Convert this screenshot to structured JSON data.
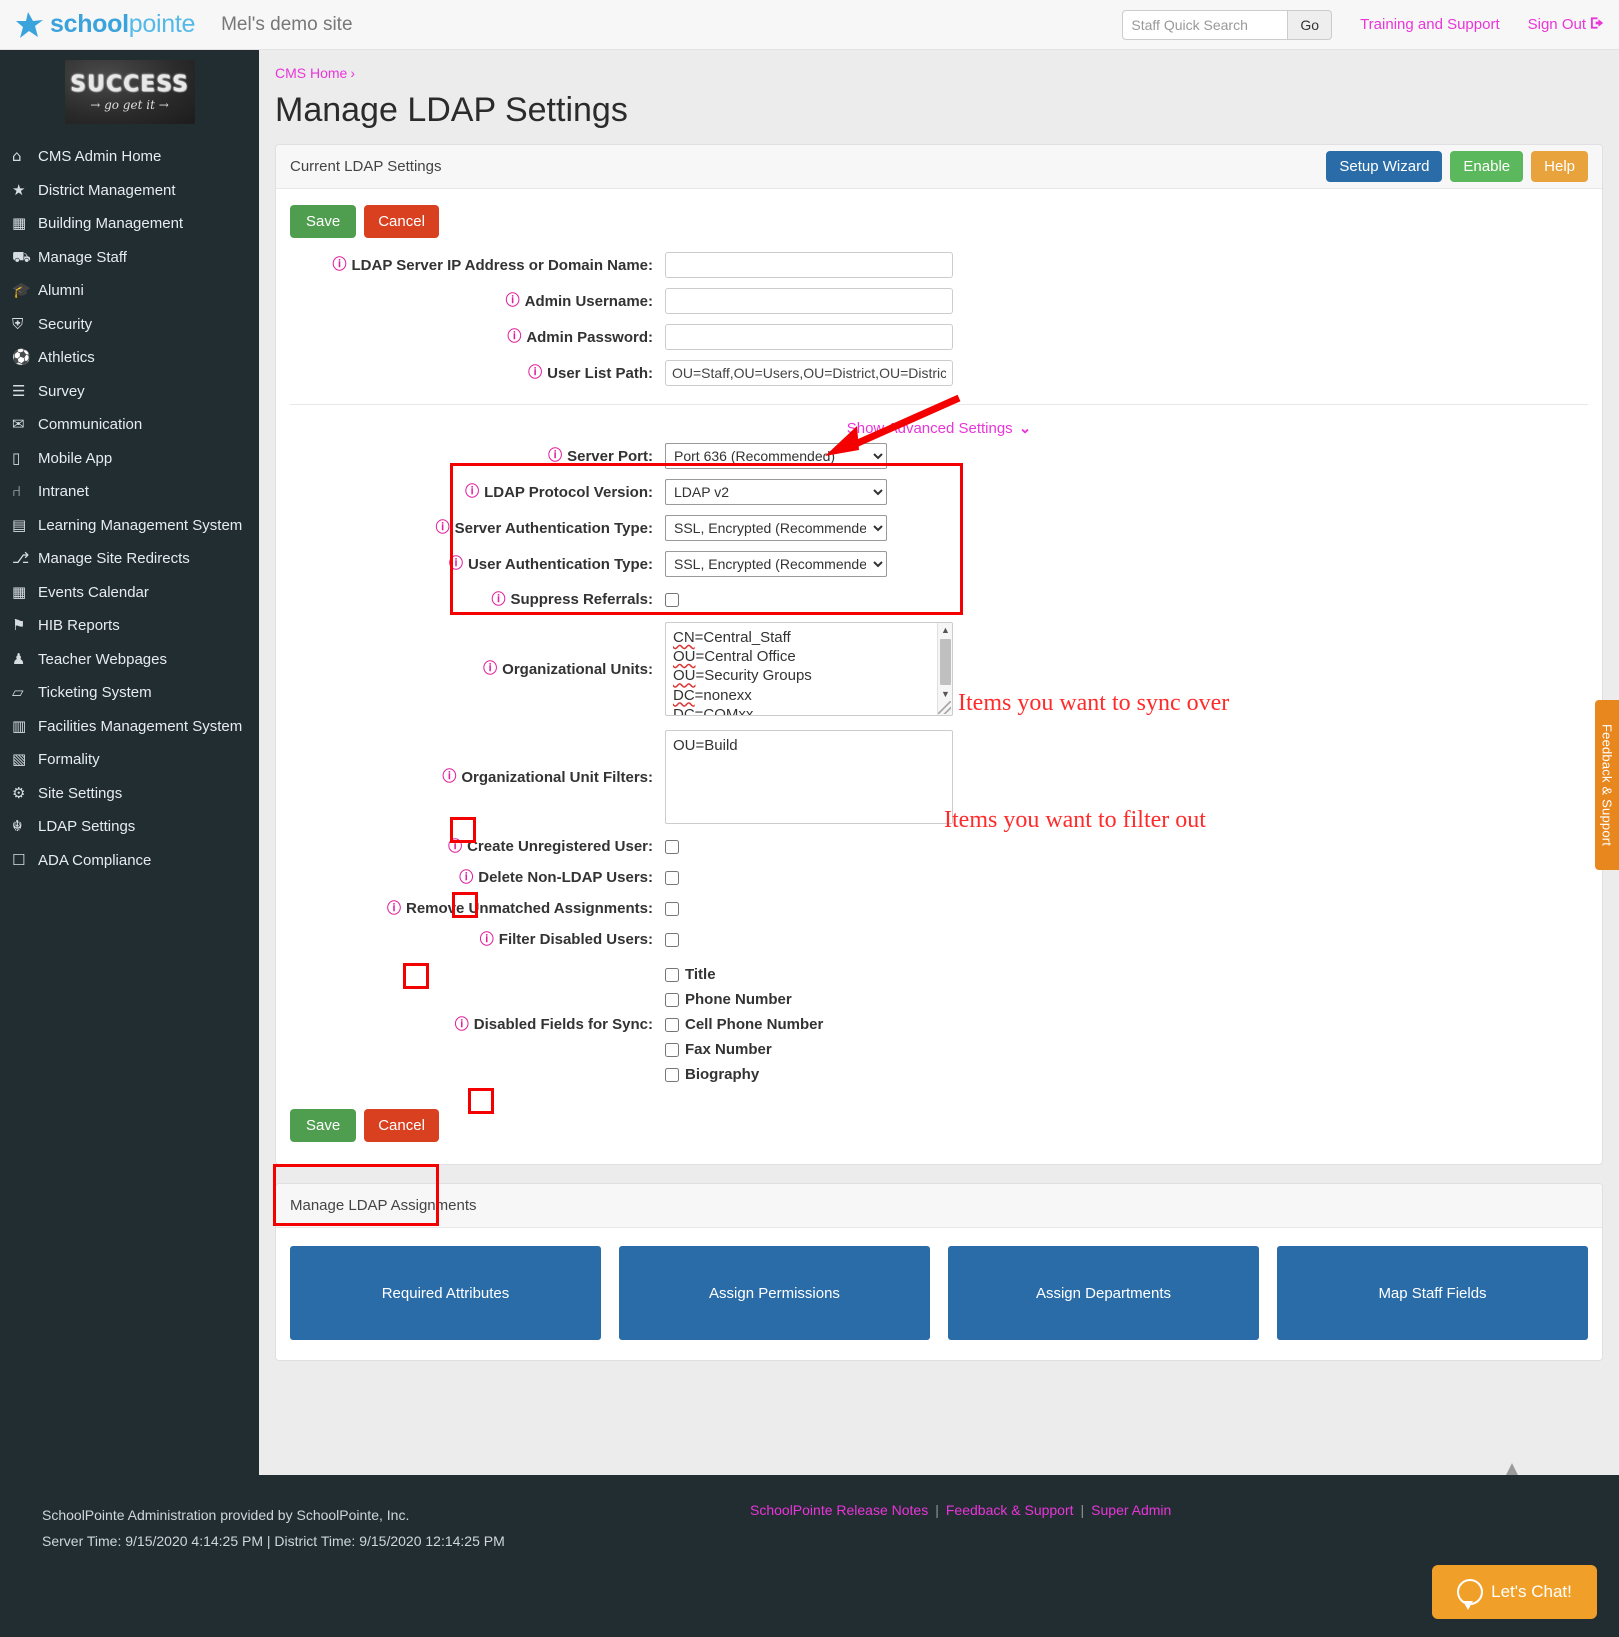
{
  "topbar": {
    "brand_bold": "school",
    "brand_light": "pointe",
    "site_name": "Mel's demo site",
    "search_placeholder": "Staff Quick Search",
    "search_value": "",
    "go_label": "Go",
    "training_link": "Training and Support",
    "signout_link": "Sign Out",
    "signout_icon": "→]"
  },
  "sidebar": {
    "logo_line1": "SUCCESS",
    "logo_line2": "→ go get it →",
    "items": [
      {
        "icon": "⌂",
        "label": "CMS Admin Home"
      },
      {
        "icon": "★",
        "label": "District Management"
      },
      {
        "icon": "▦",
        "label": "Building Management"
      },
      {
        "icon": "⛟",
        "label": "Manage Staff"
      },
      {
        "icon": "Ἱ3",
        "label": "Alumni"
      },
      {
        "icon": "⛨",
        "label": "Security"
      },
      {
        "icon": "⚽",
        "label": "Athletics"
      },
      {
        "icon": "☰",
        "label": "Survey"
      },
      {
        "icon": "✉",
        "label": "Communication"
      },
      {
        "icon": "▯",
        "label": "Mobile App"
      },
      {
        "icon": "⑁",
        "label": "Intranet"
      },
      {
        "icon": "▤",
        "label": "Learning Management System"
      },
      {
        "icon": "⎇",
        "label": "Manage Site Redirects"
      },
      {
        "icon": "▦",
        "label": "Events Calendar"
      },
      {
        "icon": "⚑",
        "label": "HIB Reports"
      },
      {
        "icon": "♟",
        "label": "Teacher Webpages"
      },
      {
        "icon": "▱",
        "label": "Ticketing System"
      },
      {
        "icon": "▥",
        "label": "Facilities Management System"
      },
      {
        "icon": "▧",
        "label": "Formality"
      },
      {
        "icon": "⚙",
        "label": "Site Settings"
      },
      {
        "icon": "☬",
        "label": "LDAP Settings"
      },
      {
        "icon": "☐",
        "label": "ADA Compliance"
      }
    ]
  },
  "breadcrumb": {
    "home": "CMS Home",
    "separator": "›"
  },
  "page_title": "Manage LDAP Settings",
  "settings_panel": {
    "header_title": "Current LDAP Settings",
    "setup_wizard": "Setup Wizard",
    "enable": "Enable",
    "help": "Help",
    "save": "Save",
    "cancel": "Cancel",
    "basic_fields": [
      {
        "label": "LDAP Server IP Address or Domain Name:",
        "value": ""
      },
      {
        "label": "Admin Username:",
        "value": ""
      },
      {
        "label": "Admin Password:",
        "value": ""
      },
      {
        "label": "User List Path:",
        "value": "OU=Staff,OU=Users,OU=District,OU=Districts,"
      }
    ],
    "show_advanced": "Show Advanced Settings",
    "show_advanced_chevron": "⌄",
    "advanced_selects": [
      {
        "label": "Server Port:",
        "value": "Port 636 (Recommended)"
      },
      {
        "label": "LDAP Protocol Version:",
        "value": "LDAP v2"
      },
      {
        "label": "Server Authentication Type:",
        "value": "SSL, Encrypted (Recommended)"
      },
      {
        "label": "User Authentication Type:",
        "value": "SSL, Encrypted (Recommended)"
      }
    ],
    "suppress_referrals_label": "Suppress Referrals:",
    "organizational_units_label": "Organizational Units:",
    "organizational_units_value": [
      "CN=Central_Staff",
      "OU=Central Office",
      "OU=Security Groups",
      "DC=nonexx",
      "DC=COMxx"
    ],
    "organizational_unit_filters_label": "Organizational Unit Filters:",
    "organizational_unit_filters_value": "OU=Build",
    "checkbox_rows": [
      {
        "label": "Create Unregistered User:",
        "checked": false
      },
      {
        "label": "Delete Non-LDAP Users:",
        "checked": false
      },
      {
        "label": "Remove Unmatched Assignments:",
        "checked": false
      },
      {
        "label": "Filter Disabled Users:",
        "checked": false
      }
    ],
    "disabled_fields_label": "Disabled Fields for Sync:",
    "disabled_fields": [
      {
        "label": "Title",
        "checked": false
      },
      {
        "label": "Phone Number",
        "checked": false
      },
      {
        "label": "Cell Phone Number",
        "checked": false
      },
      {
        "label": "Fax Number",
        "checked": false
      },
      {
        "label": "Biography",
        "checked": false
      }
    ]
  },
  "annotations": {
    "sync_over": "Items you want to sync over",
    "filter_out": "Items you want to filter out"
  },
  "assignments_panel": {
    "header_title": "Manage LDAP Assignments",
    "buttons": [
      "Required Attributes",
      "Assign Permissions",
      "Assign Departments",
      "Map Staff Fields"
    ]
  },
  "footer": {
    "admin_line": "SchoolPointe Administration provided by SchoolPointe, Inc.",
    "time_line": "Server Time: 9/15/2020 4:14:25 PM  |  District Time: 9/15/2020 12:14:25 PM",
    "links": [
      "SchoolPointe Release Notes",
      "Feedback & Support",
      "Super Admin"
    ],
    "separator": "|"
  },
  "feedback_tab": "Feedback & Support",
  "chat_button": "Let's Chat!",
  "scroll_top_icon": "▲"
}
